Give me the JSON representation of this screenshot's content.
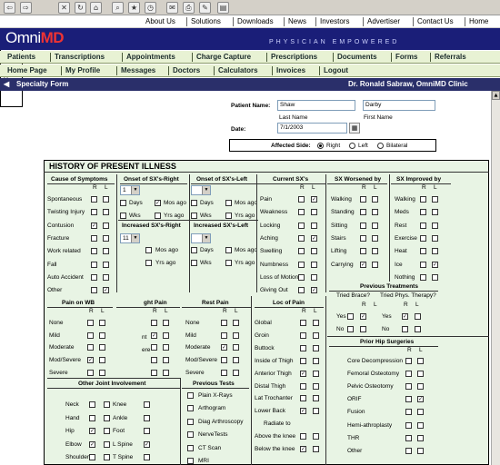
{
  "toolbar_icons": [
    "back-icon",
    "forward-icon",
    "stop-icon",
    "refresh-icon",
    "home-icon",
    "search-icon",
    "favorites-icon",
    "history-icon",
    "mail-icon",
    "print-icon",
    "edit-icon",
    "discuss-icon"
  ],
  "top_links": [
    "About Us",
    "Solutions",
    "Downloads",
    "News",
    "Investors",
    "Advertiser",
    "Contact Us",
    "Home"
  ],
  "brand": {
    "logo_a": "Omni",
    "logo_b": "MD",
    "tagline": "PHYSICIAN EMPOWERED"
  },
  "menu1": [
    "Patients",
    "Transcriptions",
    "Appointments",
    "Charge Capture",
    "Prescriptions",
    "Documents",
    "Forms",
    "Referrals"
  ],
  "menu2": [
    "Home Page",
    "My Profile",
    "Messages",
    "Doctors",
    "Calculators",
    "Invoices",
    "Logout"
  ],
  "titlebar": {
    "left": "Specialty Form",
    "right": "Dr. Ronald Sabraw, OmniMD Clinic"
  },
  "patient": {
    "name_label": "Patient Name:",
    "last": "Shaw",
    "first": "Darby",
    "last_label": "Last Name",
    "first_label": "First Name",
    "date_label": "Date:",
    "date": "7/1/2003",
    "affected_label": "Affected Side:",
    "sides": [
      "Right",
      "Left",
      "Bilateral"
    ],
    "side_selected": "Right"
  },
  "hpi": {
    "title": "HISTORY OF PRESENT ILLNESS",
    "R": "R",
    "L": "L",
    "cause": {
      "title": "Cause of Symptoms",
      "items": [
        "Spontaneous",
        "Twisting Injury",
        "Contusion",
        "Fracture",
        "Work related",
        "Fall",
        "Auto Accident",
        "Other"
      ],
      "checked_r": [
        false,
        false,
        true,
        false,
        false,
        false,
        false,
        false
      ],
      "checked_l": [
        false,
        false,
        false,
        false,
        false,
        false,
        false,
        true
      ]
    },
    "onset_right": {
      "title": "Onset of SX's-Right",
      "value": "1",
      "labels": [
        "Days",
        "Mos ago",
        "Wks",
        "Yrs ago"
      ],
      "checked": [
        false,
        true,
        false,
        false
      ]
    },
    "onset_left": {
      "title": "Onset of SX's-Left",
      "value": "",
      "labels": [
        "Days",
        "Mos ago",
        "Wks",
        "Yrs ago"
      ]
    },
    "inc_right": {
      "title": "Increased SX's-Right",
      "value": "11",
      "labels": [
        "Mos ago",
        "Yrs ago"
      ]
    },
    "inc_left": {
      "title": "Increased SX's-Left",
      "value": "",
      "labels": [
        "Days",
        "Mos ago",
        "Wks",
        "Yrs ago"
      ]
    },
    "dropdown": [
      "2",
      "3",
      "4",
      "5",
      "6",
      "7",
      "8",
      "9",
      "10",
      "11",
      "12"
    ],
    "dropdown_selected": "10",
    "current": {
      "title": "Current SX's",
      "items": [
        "Pain",
        "Weakness",
        "Locking",
        "Aching",
        "Swelling",
        "Numbness",
        "Loss of Motion",
        "Giving Out"
      ],
      "checked_l": [
        true,
        false,
        false,
        true,
        false,
        false,
        false,
        true
      ]
    },
    "worse": {
      "title": "SX Worsened by",
      "items": [
        "Walking",
        "Standing",
        "Sitting",
        "Stairs",
        "Lifting",
        "Carrying"
      ],
      "checked_r": [
        false,
        false,
        false,
        false,
        false,
        true
      ],
      "checked_l": [
        false,
        false,
        false,
        false,
        false,
        false
      ]
    },
    "improved": {
      "title": "SX Improved by",
      "items": [
        "Walking",
        "Meds",
        "Rest",
        "Exercise",
        "Heat",
        "Ice",
        "Nothing"
      ],
      "checked_l": [
        false,
        false,
        false,
        false,
        false,
        true,
        false
      ]
    },
    "wb": {
      "title": "Pain on WB",
      "items": [
        "None",
        "Mild",
        "Moderate",
        "Mod/Severe",
        "Severe"
      ],
      "checked_r": [
        false,
        false,
        false,
        true,
        false
      ]
    },
    "night": {
      "title": "ght Pain",
      "labels": [
        "nt",
        "ere"
      ]
    },
    "rest": {
      "title": "Rest Pain",
      "items": [
        "None",
        "Mild",
        "Moderate",
        "Mod/Severe",
        "Severe"
      ],
      "checked_r": [
        false,
        false,
        true,
        false,
        false
      ]
    },
    "loc": {
      "title": "Loc of Pain",
      "items": [
        "Global",
        "Groin",
        "Buttock",
        "Inside of Thigh",
        "Anterior Thigh",
        "Distal Thigh",
        "Lat Trochanter",
        "Lower Back",
        "Radiate to",
        "Above the knee",
        "Below the knee"
      ],
      "checked_r": [
        false,
        false,
        false,
        false,
        true,
        false,
        false,
        true,
        false,
        false,
        true
      ]
    },
    "prev": {
      "title": "Previous Treatments",
      "brace": "Tried Brace?",
      "therapy": "Tried Phys. Therapy?",
      "yes": "Yes",
      "no": "No"
    },
    "surg": {
      "title": "Prior Hip Surgeries",
      "items": [
        "Core Decompression",
        "Femoral Osteotomy",
        "Pelvic Osteotomy",
        "ORIF",
        "Fusion",
        "Hemi-athroplasty",
        "THR",
        "Other"
      ],
      "checked_l": [
        false,
        false,
        false,
        true,
        false,
        false,
        false,
        false
      ]
    },
    "joint": {
      "title": "Other Joint Involvement",
      "left": [
        "Neck",
        "Hand",
        "Hip",
        "Elbow",
        "Shoulder"
      ],
      "right": [
        "Knee",
        "Ankle",
        "Foot",
        "L Spine",
        "T Spine"
      ]
    },
    "tests": {
      "title": "Previous Tests",
      "items": [
        "Plain X-Rays",
        "Arthogram",
        "Diag Arthroscopy",
        "NerveTests",
        "CT Scan",
        "MRI"
      ]
    }
  },
  "colors": {
    "banner": "#1a1e78",
    "menu": "#e8f2d4",
    "titlebar": "#2a2f6a",
    "section": "#e8f4e4"
  }
}
